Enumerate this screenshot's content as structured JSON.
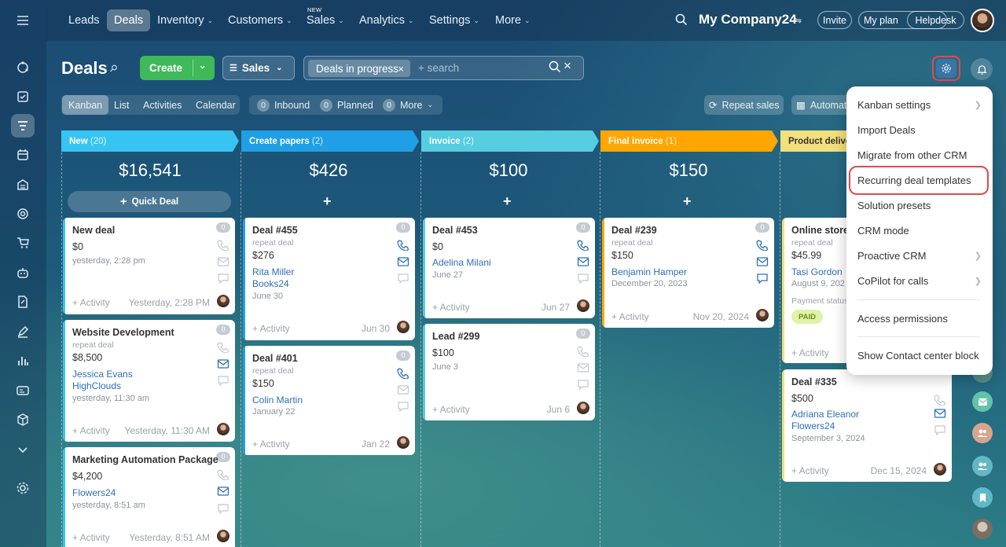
{
  "nav": {
    "items": [
      {
        "label": "Leads"
      },
      {
        "label": "Deals"
      },
      {
        "label": "Inventory"
      },
      {
        "label": "Customers"
      },
      {
        "label": "Sales",
        "badge": "NEW"
      },
      {
        "label": "Analytics"
      },
      {
        "label": "Settings"
      },
      {
        "label": "More"
      }
    ],
    "company": "My Company24",
    "invite": "Invite",
    "my_plan": "My plan",
    "helpdesk": "Helpdesk"
  },
  "page": {
    "title": "Deals",
    "create": "Create",
    "pipeline": "Sales",
    "filter_chip": "Deals in progress",
    "search_placeholder": "+ search"
  },
  "views": {
    "kanban": "Kanban",
    "list": "List",
    "activities": "Activities",
    "calendar": "Calendar",
    "inbound_count": "0",
    "inbound": "Inbound",
    "planned_count": "0",
    "planned": "Planned",
    "more_count": "0",
    "more": "More",
    "repeat_sales": "Repeat sales",
    "automation": "Automati"
  },
  "columns": [
    {
      "name": "New",
      "count": "(20)",
      "sum": "$16,541",
      "quick": "Quick Deal",
      "color": "#38c4f2"
    },
    {
      "name": "Create papers",
      "count": "(2)",
      "sum": "$426",
      "color": "#1fa0e6"
    },
    {
      "name": "Invoice",
      "count": "(2)",
      "sum": "$100",
      "color": "#56cde0"
    },
    {
      "name": "Final invoice",
      "count": "(1)",
      "sum": "$150",
      "color": "#ffa600"
    },
    {
      "name": "Product delive",
      "count": "",
      "sum": "",
      "color": "#f2e07c"
    }
  ],
  "cards": {
    "new_deal": {
      "title": "New deal",
      "amount": "$0",
      "date": "yesterday, 2:28 pm",
      "activity": "+ Activity",
      "time": "Yesterday, 2:28 PM",
      "badge": "0"
    },
    "website": {
      "title": "Website Development",
      "sub": "repeat deal",
      "amount": "$8,500",
      "contact": "Jessica Evans",
      "company": "HighClouds",
      "date": "yesterday, 11:30 am",
      "activity": "+ Activity",
      "time": "Yesterday, 11:30 AM",
      "badge": "0"
    },
    "marketing": {
      "title": "Marketing Automation Package",
      "amount": "$4,200",
      "company": "Flowers24",
      "date": "yesterday, 8:51 am",
      "activity": "+ Activity",
      "time": "Yesterday, 8:51 AM",
      "badge": "0"
    },
    "d455": {
      "title": "Deal #455",
      "sub": "repeat deal",
      "amount": "$276",
      "contact": "Rita Miller",
      "company": "Books24",
      "date": "June 30",
      "activity": "+ Activity",
      "time": "Jun 30",
      "badge": "0"
    },
    "d401": {
      "title": "Deal #401",
      "sub": "repeat deal",
      "amount": "$150",
      "contact": "Colin Martin",
      "date": "January 22",
      "activity": "+ Activity",
      "time": "Jan 22",
      "badge": "0"
    },
    "d453": {
      "title": "Deal #453",
      "amount": "$0",
      "contact": "Adelina Milani",
      "date": "June 27",
      "activity": "+ Activity",
      "time": "Jun 27",
      "badge": "0"
    },
    "l299": {
      "title": "Lead #299",
      "amount": "$100",
      "date": "June 3",
      "activity": "+ Activity",
      "time": "Jun 6",
      "badge": "0"
    },
    "d239": {
      "title": "Deal #239",
      "sub": "repeat deal",
      "amount": "$150",
      "contact": "Benjamin Hamper",
      "date": "December 20, 2023",
      "activity": "+ Activity",
      "time": "Nov 20, 2024",
      "badge": "0"
    },
    "online": {
      "title": "Online store",
      "sub": "repeat deal",
      "amount": "$45.99",
      "contact": "Tasi Gordon",
      "date": "August 9, 202",
      "payment": "Payment status",
      "paid": "PAID",
      "activity": "+ Activity"
    },
    "d335": {
      "title": "Deal #335",
      "amount": "$500",
      "contact": "Adriana Eleanor",
      "company": "Flowers24",
      "date": "September 3, 2024",
      "activity": "+ Activity",
      "time": "Dec 15, 2024"
    }
  },
  "menu": {
    "items": [
      "Kanban settings",
      "Import Deals",
      "Migrate from other CRM",
      "Recurring deal templates",
      "Solution presets",
      "CRM mode",
      "Proactive CRM",
      "CoPilot for calls",
      "Access permissions",
      "Show Contact center block"
    ]
  },
  "colors": {
    "accent_green": "#3fb959",
    "highlight": "#e8474c",
    "link": "#2e6fb8"
  }
}
